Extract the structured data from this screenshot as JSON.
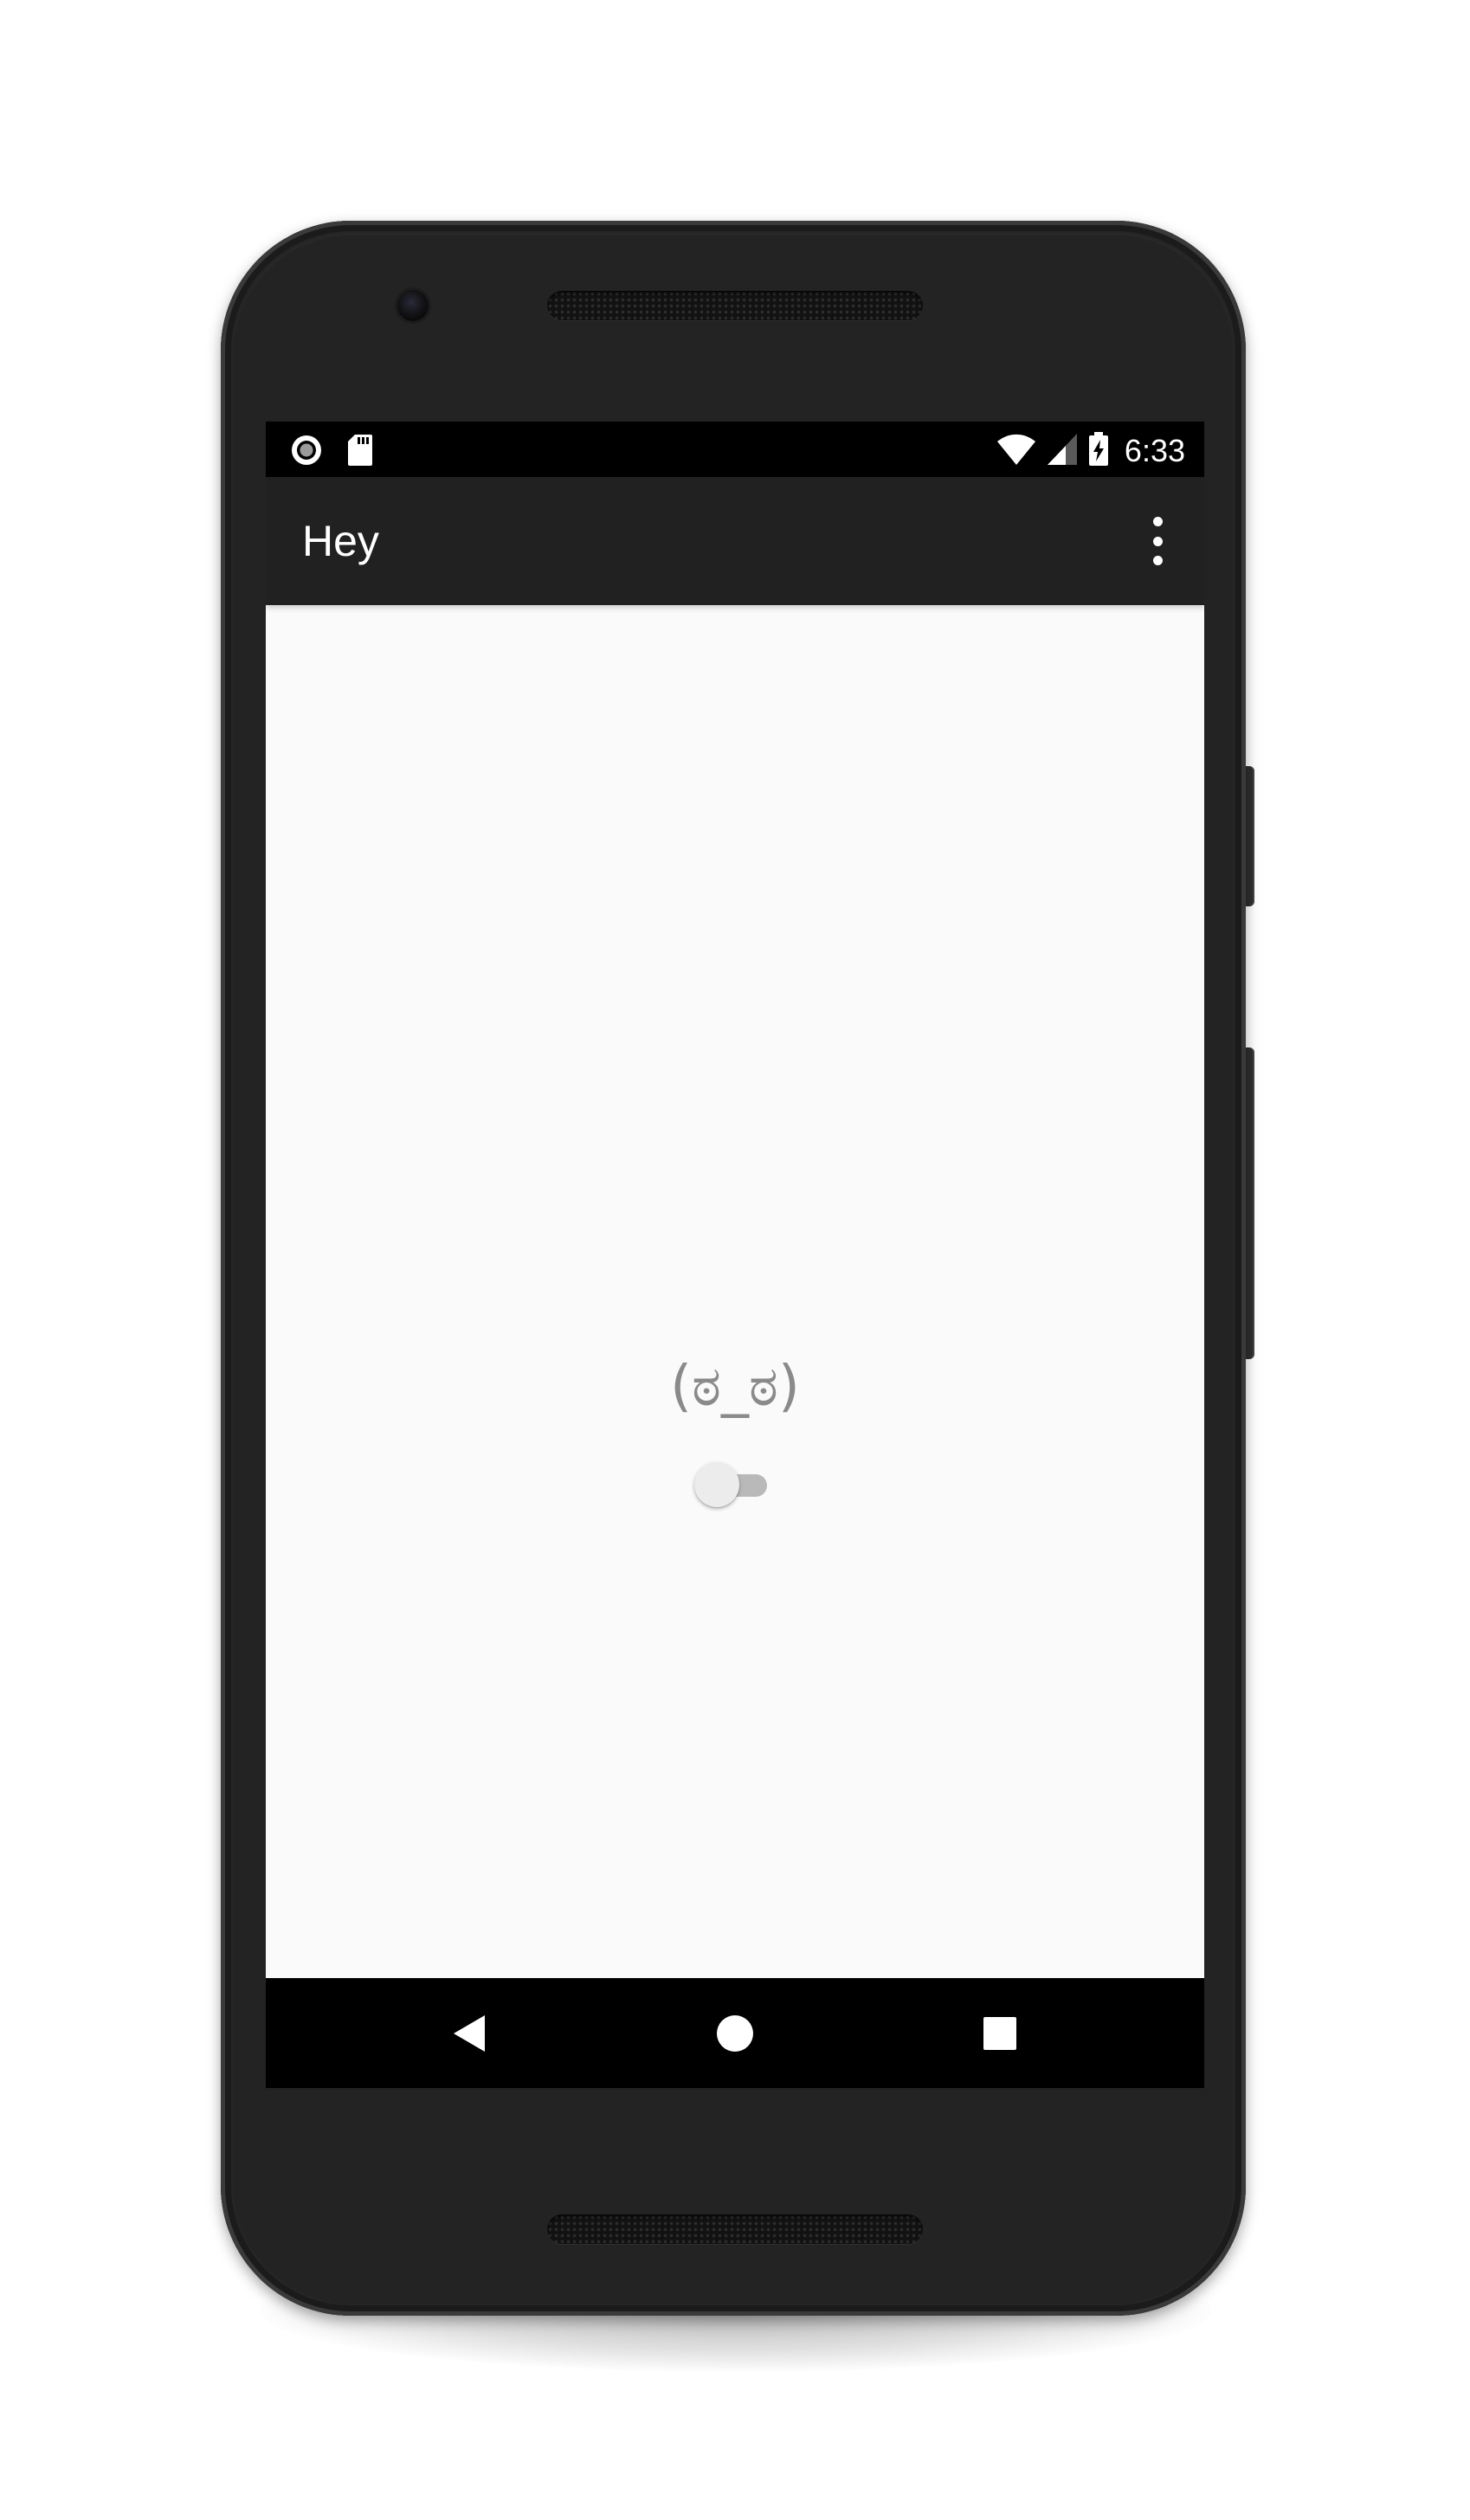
{
  "status_bar": {
    "time": "6:33",
    "left_icons": [
      "record-icon",
      "sd-card-icon"
    ],
    "right_icons": [
      "wifi-icon",
      "cell-signal-icon",
      "battery-charging-icon"
    ]
  },
  "app_bar": {
    "title": "Hey",
    "overflow_icon": "more-vert-icon"
  },
  "content": {
    "face": "(ಠ_ಠ)",
    "toggle": {
      "checked": false
    }
  },
  "nav_bar": {
    "buttons": [
      "back-icon",
      "home-icon",
      "recents-icon"
    ]
  },
  "colors": {
    "status_bar": "#000000",
    "app_bar": "#212121",
    "background": "#fafafa",
    "face_text": "#8a8a8a",
    "switch_track": "#b9b9b9",
    "switch_thumb": "#ececec",
    "nav_bar": "#000000",
    "device_body": "#252525"
  }
}
